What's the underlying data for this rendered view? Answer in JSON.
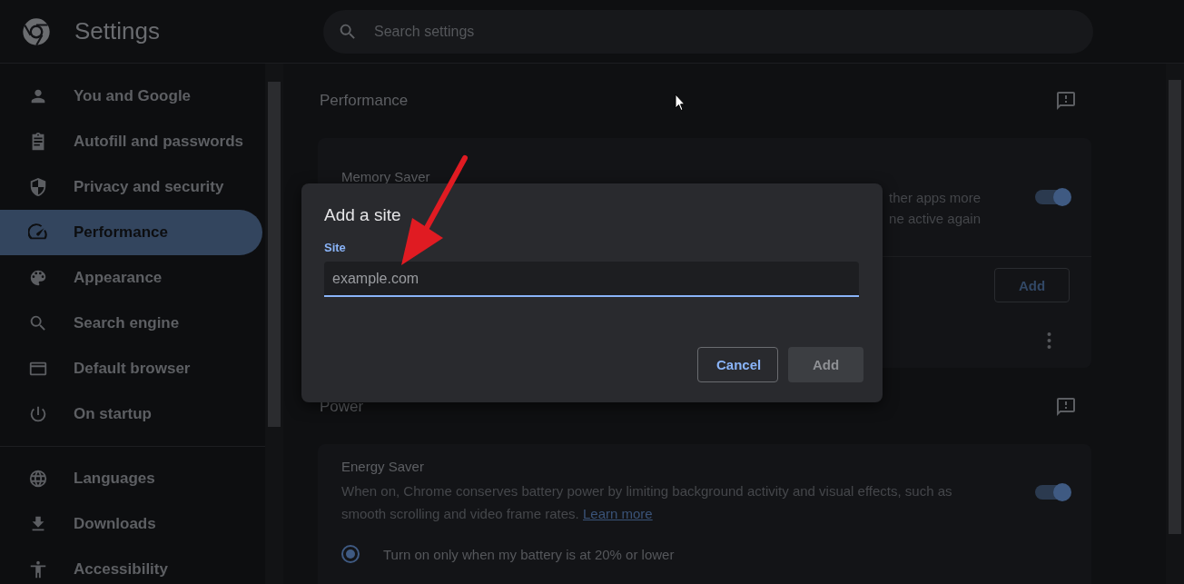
{
  "header": {
    "title": "Settings",
    "search": {
      "placeholder": "Search settings"
    }
  },
  "sidebar": {
    "items": [
      {
        "label": "You and Google",
        "selected": false
      },
      {
        "label": "Autofill and passwords",
        "selected": false
      },
      {
        "label": "Privacy and security",
        "selected": false
      },
      {
        "label": "Performance",
        "selected": true
      },
      {
        "label": "Appearance",
        "selected": false
      },
      {
        "label": "Search engine",
        "selected": false
      },
      {
        "label": "Default browser",
        "selected": false
      },
      {
        "label": "On startup",
        "selected": false
      }
    ],
    "items_2": [
      {
        "label": "Languages",
        "selected": false
      },
      {
        "label": "Downloads",
        "selected": false
      },
      {
        "label": "Accessibility",
        "selected": false
      }
    ]
  },
  "performance": {
    "title": "Performance",
    "memory_saver": {
      "title": "Memory Saver",
      "description_visible": [
        "ther apps more",
        "ne active again"
      ],
      "on": true
    },
    "add_button": "Add"
  },
  "power": {
    "title": "Power",
    "energy_saver": {
      "title": "Energy Saver",
      "description": "When on, Chrome conserves battery power by limiting background activity and visual effects, such as smooth scrolling and video frame rates.",
      "link": "Learn more",
      "on": true
    },
    "options": [
      {
        "label": "Turn on only when my battery is at 20% or lower",
        "selected": true
      }
    ]
  },
  "dialog": {
    "title": "Add a site",
    "field": {
      "label": "Site",
      "placeholder": "example.com"
    },
    "buttons": [
      {
        "label": "Cancel",
        "kind": "secondary",
        "disabled": false
      },
      {
        "label": "Add",
        "kind": "primary",
        "disabled": true
      }
    ]
  }
}
